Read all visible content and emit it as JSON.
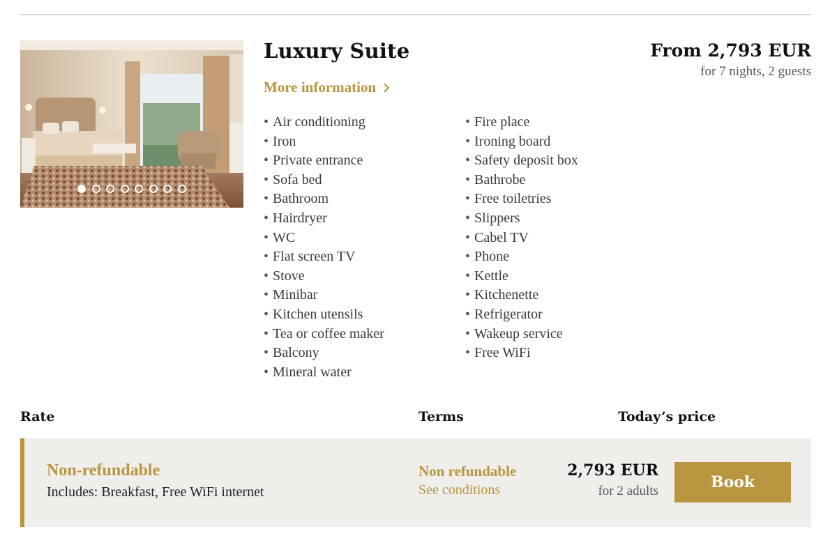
{
  "room": {
    "title": "Luxury Suite",
    "more_info_label": "More information",
    "price_from": "From 2,793 EUR",
    "price_sub": "for 7 nights, 2 guests",
    "gallery": {
      "slide_count": 8,
      "active_slide": 1
    }
  },
  "amenities": {
    "col1": [
      "Air conditioning",
      "Iron",
      "Private entrance",
      "Sofa bed",
      "Bathroom",
      "Hairdryer",
      "WC",
      "Flat screen TV",
      "Stove",
      "Minibar",
      "Kitchen utensils",
      "Tea or coffee maker",
      "Balcony",
      "Mineral water"
    ],
    "col2": [
      "Fire place",
      "Ironing board",
      "Safety deposit box",
      "Bathrobe",
      "Free toiletries",
      "Slippers",
      "Cabel TV",
      "Phone",
      "Kettle",
      "Kitchenette",
      "Refrigerator",
      "Wakeup service",
      "Free WiFi"
    ]
  },
  "table": {
    "headers": {
      "rate": "Rate",
      "terms": "Terms",
      "price": "Today’s price"
    },
    "rows": [
      {
        "rate_name": "Non-refundable",
        "includes": "Includes: Breakfast, Free WiFi internet",
        "terms": "Non refundable",
        "terms_link": "See conditions",
        "price": "2,793 EUR",
        "price_sub": "for 2 adults",
        "book_label": "Book"
      }
    ]
  },
  "colors": {
    "accent": "#b7963f",
    "row_bg": "#efeeeb",
    "rule": "#d9d9d9"
  },
  "icons": {
    "more_info": "chevron-right-icon"
  }
}
